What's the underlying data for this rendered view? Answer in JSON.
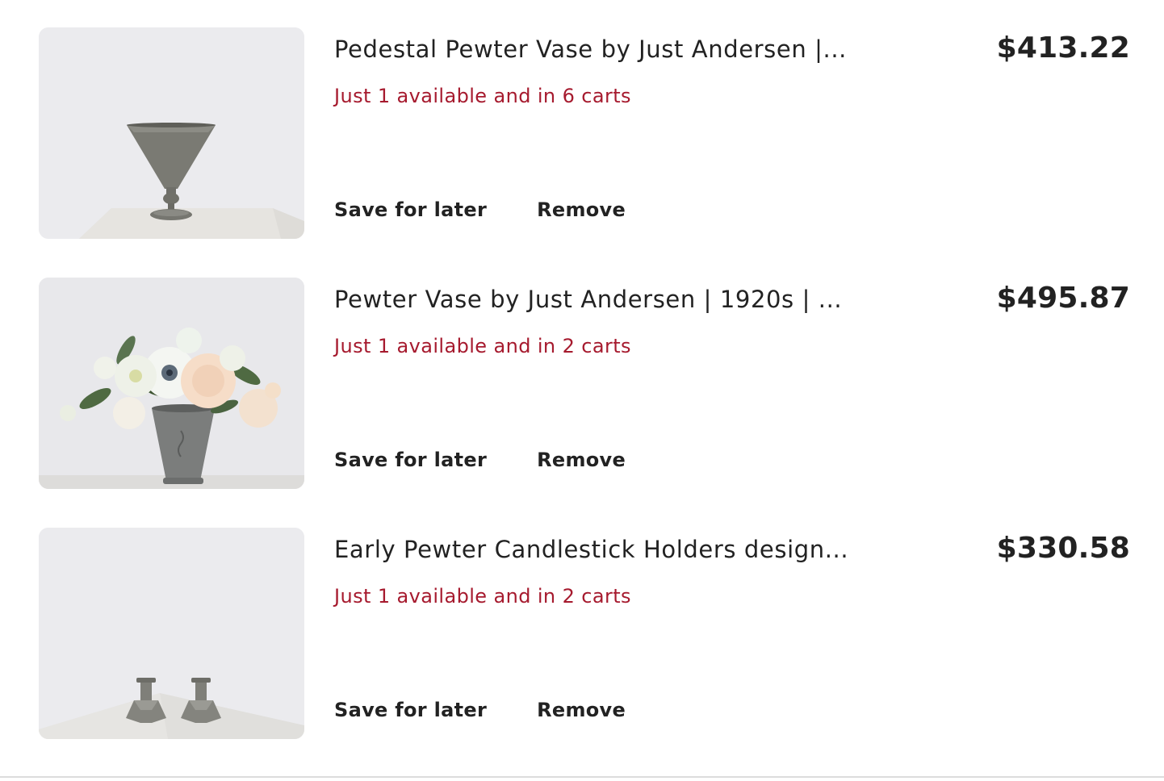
{
  "items": [
    {
      "title": "Pedestal Pewter Vase by Just Andersen |...",
      "availability": "Just 1 available and in 6 carts",
      "price": "$413.22",
      "save_label": "Save for later",
      "remove_label": "Remove",
      "image_icon": "pedestal-vase-photo"
    },
    {
      "title": "Pewter Vase by Just Andersen | 1920s | ...",
      "availability": "Just 1 available and in 2 carts",
      "price": "$495.87",
      "save_label": "Save for later",
      "remove_label": "Remove",
      "image_icon": "flower-vase-photo"
    },
    {
      "title": "Early Pewter Candlestick Holders design...",
      "availability": "Just 1 available and in 2 carts",
      "price": "$330.58",
      "save_label": "Save for later",
      "remove_label": "Remove",
      "image_icon": "candlesticks-photo"
    }
  ],
  "colors": {
    "availability": "#a61a2e",
    "text": "#222222",
    "thumbnail_bg": "#ebebed"
  }
}
